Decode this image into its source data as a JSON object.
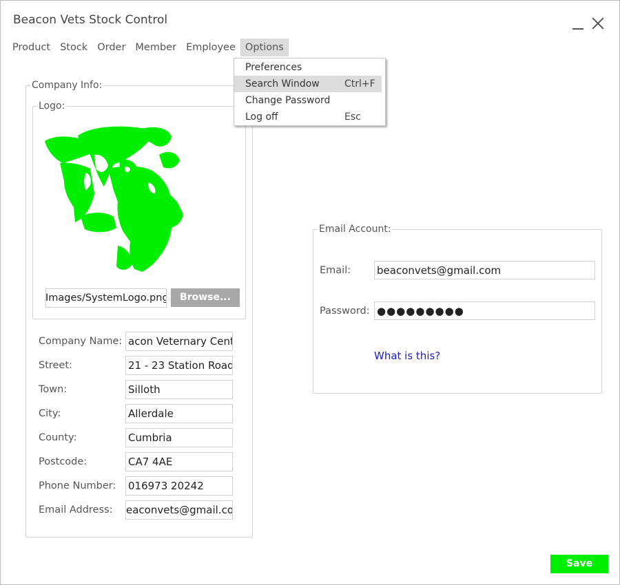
{
  "window": {
    "title": "Beacon Vets Stock Control"
  },
  "menu": [
    "Product",
    "Stock",
    "Order",
    "Member",
    "Employee",
    "Options"
  ],
  "options_menu": {
    "items": [
      {
        "label": "Preferences",
        "shortcut": ""
      },
      {
        "label": "Search Window",
        "shortcut": "Ctrl+F"
      },
      {
        "label": "Change Password",
        "shortcut": ""
      },
      {
        "label": "Log off",
        "shortcut": "Esc"
      }
    ]
  },
  "company": {
    "legend": "Company Info:",
    "logo_legend": "Logo:",
    "logo_path": "Images/SystemLogo.png",
    "browse_label": "Browse...",
    "fields": [
      {
        "label": "Company Name:",
        "value": "acon Veternary Center"
      },
      {
        "label": "Street:",
        "value": "21 - 23 Station Road"
      },
      {
        "label": "Town:",
        "value": "Silloth"
      },
      {
        "label": "City:",
        "value": "Allerdale"
      },
      {
        "label": "County:",
        "value": "Cumbria"
      },
      {
        "label": "Postcode:",
        "value": "CA7 4AE"
      },
      {
        "label": "Phone Number:",
        "value": "016973 20242"
      },
      {
        "label": "Email Address:",
        "value": "eaconvets@gmail.com"
      }
    ]
  },
  "email_account": {
    "legend": "Email Account:",
    "email_label": "Email:",
    "email_value": "beaconvets@gmail.com",
    "password_label": "Password:",
    "password_value": "●●●●●●●●●",
    "help_link": "What is this?"
  },
  "save_label": "Save",
  "colors": {
    "accent_green": "#00ee00",
    "menu_highlight": "#dcdcdc",
    "link": "#1a1ac8"
  }
}
